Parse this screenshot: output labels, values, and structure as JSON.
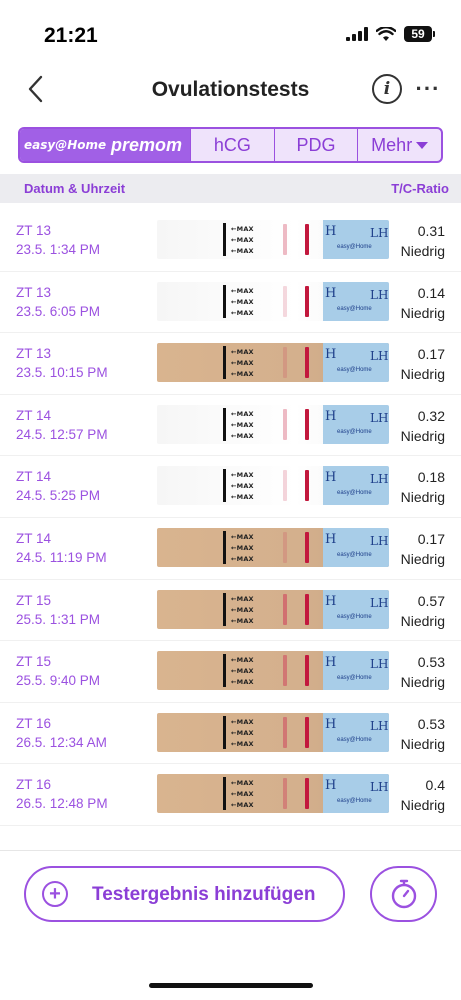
{
  "status": {
    "time": "21:21",
    "battery": "59"
  },
  "nav": {
    "title": "Ovulationstests",
    "info_icon": "i",
    "more_icon": "···"
  },
  "tabs": {
    "brand_easy": "easy@Home",
    "brand_premom": "premom",
    "items": [
      {
        "label": "hCG"
      },
      {
        "label": "PDG"
      },
      {
        "label": "Mehr"
      }
    ]
  },
  "table": {
    "col_left": "Datum & Uhrzeit",
    "col_right": "T/C-Ratio",
    "rows": [
      {
        "day": "ZT 13",
        "datetime": "23.5. 1:34 PM",
        "ratio": "0.31",
        "level": "Niedrig",
        "tint": "white",
        "t_intensity": 0.35
      },
      {
        "day": "ZT 13",
        "datetime": "23.5. 6:05 PM",
        "ratio": "0.14",
        "level": "Niedrig",
        "tint": "white",
        "t_intensity": 0.2
      },
      {
        "day": "ZT 13",
        "datetime": "23.5. 10:15 PM",
        "ratio": "0.17",
        "level": "Niedrig",
        "tint": "tan",
        "t_intensity": 0.2
      },
      {
        "day": "ZT 14",
        "datetime": "24.5. 12:57 PM",
        "ratio": "0.32",
        "level": "Niedrig",
        "tint": "white",
        "t_intensity": 0.35
      },
      {
        "day": "ZT 14",
        "datetime": "24.5. 5:25 PM",
        "ratio": "0.18",
        "level": "Niedrig",
        "tint": "white",
        "t_intensity": 0.22
      },
      {
        "day": "ZT 14",
        "datetime": "24.5. 11:19 PM",
        "ratio": "0.17",
        "level": "Niedrig",
        "tint": "tan",
        "t_intensity": 0.2
      },
      {
        "day": "ZT 15",
        "datetime": "25.5. 1:31 PM",
        "ratio": "0.57",
        "level": "Niedrig",
        "tint": "tan",
        "t_intensity": 0.55
      },
      {
        "day": "ZT 15",
        "datetime": "25.5. 9:40 PM",
        "ratio": "0.53",
        "level": "Niedrig",
        "tint": "tan",
        "t_intensity": 0.5
      },
      {
        "day": "ZT 16",
        "datetime": "26.5. 12:34 AM",
        "ratio": "0.53",
        "level": "Niedrig",
        "tint": "tan",
        "t_intensity": 0.5
      },
      {
        "day": "ZT 16",
        "datetime": "26.5. 12:48 PM",
        "ratio": "0.4",
        "level": "Niedrig",
        "tint": "tan",
        "t_intensity": 0.4
      }
    ]
  },
  "actions": {
    "add_label": "Testergebnis hinzufügen"
  },
  "colors": {
    "accent": "#9b51e0",
    "header_bg": "#ececf0",
    "control_line": "#c2183d"
  }
}
